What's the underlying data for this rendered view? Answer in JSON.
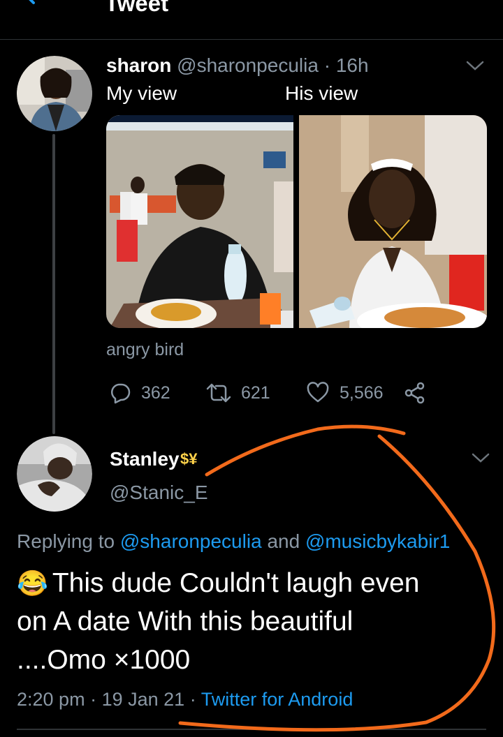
{
  "header": {
    "title": "Tweet",
    "back_icon": "back-arrow-icon"
  },
  "tweet": {
    "name": "sharon",
    "handle": "@sharonpeculia",
    "separator": "·",
    "time": "16h",
    "text_left": "My view",
    "text_right": "His view",
    "caption": "angry bird",
    "replies": "362",
    "retweets": "621",
    "likes": "5,566"
  },
  "reply": {
    "name": "Stanley",
    "badge": "$¥",
    "handle": "@Stanic_E",
    "replying_prefix": "Replying to",
    "mention1": "@sharonpeculia",
    "and": "and",
    "mention2": "@musicbykabir1",
    "emoji": "😂",
    "text": "This dude Couldn't laugh even on A date With this beautiful ....Omo ×1000",
    "time": "2:20 pm",
    "dot": "·",
    "date": "19 Jan 21",
    "client": "Twitter for Android"
  },
  "colors": {
    "background": "#000000",
    "secondary_text": "#8b98a5",
    "link": "#1d9bf0",
    "marker": "#f26a1b"
  }
}
